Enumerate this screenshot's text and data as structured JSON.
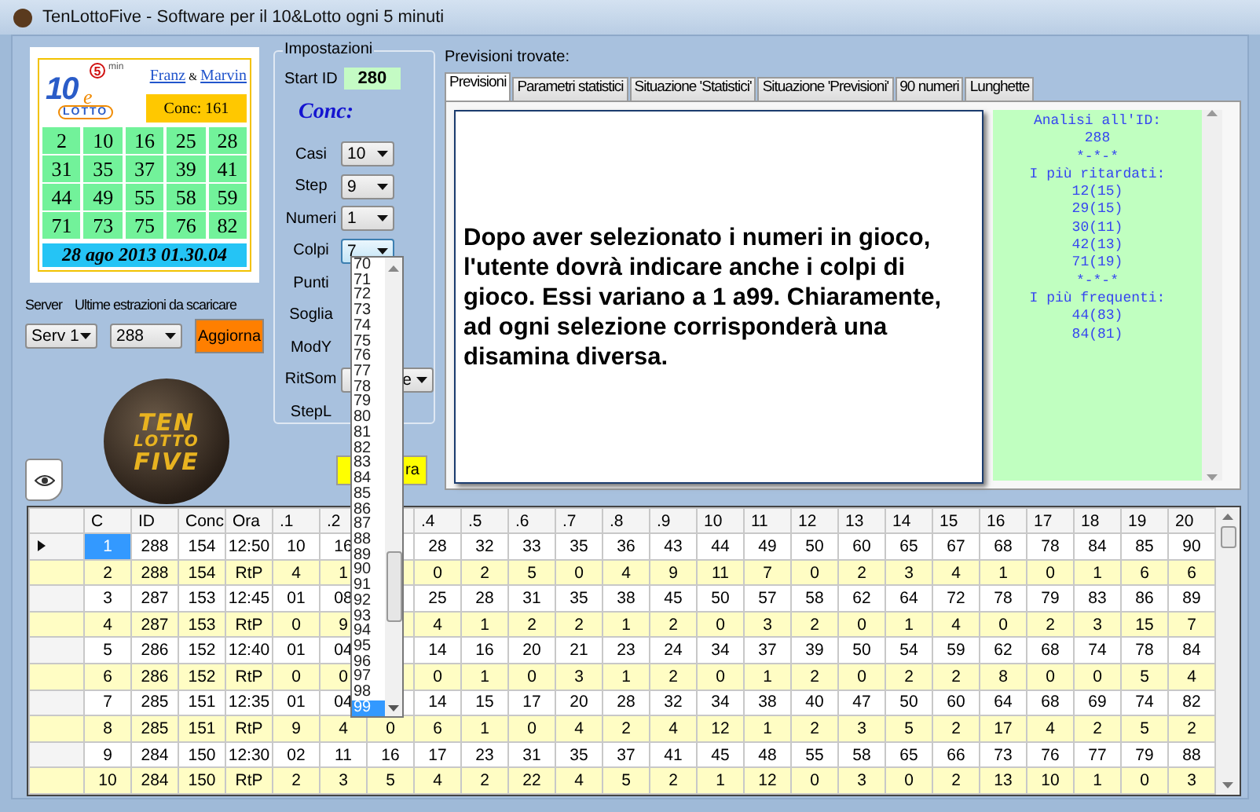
{
  "window": {
    "title": "TenLottoFive - Software per il 10&Lotto ogni 5 minuti"
  },
  "ticket": {
    "logo": {
      "number": "10",
      "letter": "e",
      "word": "LOTTO",
      "badge": "5",
      "unit": "min"
    },
    "authors": [
      "Franz",
      "Marvin"
    ],
    "separator": "&",
    "conc": "Conc: 161",
    "numbers": [
      "2",
      "10",
      "16",
      "25",
      "28",
      "31",
      "35",
      "37",
      "39",
      "41",
      "44",
      "49",
      "55",
      "58",
      "59",
      "71",
      "73",
      "75",
      "76",
      "82"
    ],
    "date": "28 ago 2013 01.30.04"
  },
  "server": {
    "label": "Server",
    "value": "Serv 1"
  },
  "download": {
    "label": "Ultime estrazioni da scaricare",
    "value": "288"
  },
  "update_button": "Aggiorna",
  "brand_logo": [
    "TEN",
    "LOTTO",
    "FIVE"
  ],
  "settings": {
    "title": "Impostazioni",
    "start_id": {
      "label": "Start ID",
      "value": "280"
    },
    "heading": "Conc:",
    "fields": [
      {
        "label": "Casi",
        "kind": "combo",
        "value": "10",
        "expanded": false
      },
      {
        "label": "Step",
        "kind": "combo",
        "value": "9",
        "expanded": false
      },
      {
        "label": "Numeri",
        "kind": "combo",
        "value": "1",
        "expanded": false
      },
      {
        "label": "Colpi",
        "kind": "combo",
        "value": "7",
        "expanded": true
      },
      {
        "label": "Punti",
        "kind": "label"
      },
      {
        "label": "Soglia",
        "kind": "label"
      },
      {
        "label": "ModY",
        "kind": "label"
      },
      {
        "label": "RitSom",
        "kind": "tail",
        "value": "e"
      },
      {
        "label": "StepL",
        "kind": "label"
      }
    ]
  },
  "dropdown": {
    "options": [
      {
        "label": "70",
        "selected": false
      },
      {
        "label": "71",
        "selected": false
      },
      {
        "label": "72",
        "selected": false
      },
      {
        "label": "73",
        "selected": false
      },
      {
        "label": "74",
        "selected": false
      },
      {
        "label": "75",
        "selected": false
      },
      {
        "label": "76",
        "selected": false
      },
      {
        "label": "77",
        "selected": false
      },
      {
        "label": "78",
        "selected": false
      },
      {
        "label": "79",
        "selected": false
      },
      {
        "label": "80",
        "selected": false
      },
      {
        "label": "81",
        "selected": false
      },
      {
        "label": "82",
        "selected": false
      },
      {
        "label": "83",
        "selected": false
      },
      {
        "label": "84",
        "selected": false
      },
      {
        "label": "85",
        "selected": false
      },
      {
        "label": "86",
        "selected": false
      },
      {
        "label": "87",
        "selected": false
      },
      {
        "label": "88",
        "selected": false
      },
      {
        "label": "89",
        "selected": false
      },
      {
        "label": "90",
        "selected": false
      },
      {
        "label": "91",
        "selected": false
      },
      {
        "label": "92",
        "selected": false
      },
      {
        "label": "93",
        "selected": false
      },
      {
        "label": "94",
        "selected": false
      },
      {
        "label": "95",
        "selected": false
      },
      {
        "label": "96",
        "selected": false
      },
      {
        "label": "97",
        "selected": false
      },
      {
        "label": "98",
        "selected": false
      },
      {
        "label": "99",
        "selected": true
      }
    ]
  },
  "action_button": "ra",
  "results_label": "Previsioni trovate:",
  "tabs": [
    {
      "label": "Previsioni",
      "selected": true
    },
    {
      "label": "Parametri statistici",
      "selected": false
    },
    {
      "label": "Situazione 'Statistici'",
      "selected": false
    },
    {
      "label": "Situazione 'Previsioni'",
      "selected": false
    },
    {
      "label": "90 numeri",
      "selected": false
    },
    {
      "label": "Lunghette",
      "selected": false
    }
  ],
  "message": "Dopo aver selezionato i numeri in gioco, l'utente dovrà indicare anche i colpi di gioco. Essi variano a 1 a99. Chiaramente, ad ogni selezione corrisponderà una disamina diversa.",
  "analysis": [
    "Analisi all'ID:",
    "288",
    "*-*-*",
    "I più ritardati:",
    "12(15)",
    "29(15)",
    "30(11)",
    "42(13)",
    "71(19)",
    "*-*-*",
    "I più frequenti:",
    "44(83)",
    "84(81)"
  ],
  "table": {
    "columns": [
      "C",
      "ID",
      "Conc",
      "Ora",
      ".1",
      ".2",
      null,
      ".4",
      ".5",
      ".6",
      ".7",
      ".8",
      ".9",
      "10",
      "11",
      "12",
      "13",
      "14",
      "15",
      "16",
      "17",
      "18",
      "19",
      "20"
    ],
    "rows": [
      {
        "kind": "draw",
        "selected": true,
        "cells": [
          "1",
          "288",
          "154",
          "12:50",
          "10",
          "16",
          null,
          "28",
          "32",
          "33",
          "35",
          "36",
          "43",
          "44",
          "49",
          "50",
          "60",
          "65",
          "67",
          "68",
          "78",
          "84",
          "85",
          "90"
        ]
      },
      {
        "kind": "delay",
        "selected": false,
        "cells": [
          "2",
          "288",
          "154",
          "RtP",
          "4",
          "1",
          null,
          "0",
          "2",
          "5",
          "0",
          "4",
          "9",
          "11",
          "7",
          "0",
          "2",
          "3",
          "4",
          "1",
          "0",
          "1",
          "6",
          "6"
        ]
      },
      {
        "kind": "draw",
        "selected": false,
        "cells": [
          "3",
          "287",
          "153",
          "12:45",
          "01",
          "08",
          null,
          "25",
          "28",
          "31",
          "35",
          "38",
          "45",
          "50",
          "57",
          "58",
          "62",
          "64",
          "72",
          "78",
          "79",
          "83",
          "86",
          "89"
        ]
      },
      {
        "kind": "delay",
        "selected": false,
        "cells": [
          "4",
          "287",
          "153",
          "RtP",
          "0",
          "9",
          null,
          "4",
          "1",
          "2",
          "2",
          "1",
          "2",
          "0",
          "3",
          "2",
          "0",
          "1",
          "4",
          "0",
          "2",
          "3",
          "15",
          "7"
        ]
      },
      {
        "kind": "draw",
        "selected": false,
        "cells": [
          "5",
          "286",
          "152",
          "12:40",
          "01",
          "04",
          null,
          "14",
          "16",
          "20",
          "21",
          "23",
          "24",
          "34",
          "37",
          "39",
          "50",
          "54",
          "59",
          "62",
          "68",
          "74",
          "78",
          "84"
        ]
      },
      {
        "kind": "delay",
        "selected": false,
        "cells": [
          "6",
          "286",
          "152",
          "RtP",
          "0",
          "0",
          null,
          "0",
          "1",
          "0",
          "3",
          "1",
          "2",
          "0",
          "1",
          "2",
          "0",
          "2",
          "2",
          "8",
          "0",
          "0",
          "5",
          "4"
        ]
      },
      {
        "kind": "draw",
        "selected": false,
        "cells": [
          "7",
          "285",
          "151",
          "12:35",
          "01",
          "04",
          null,
          "14",
          "15",
          "17",
          "20",
          "28",
          "32",
          "34",
          "38",
          "40",
          "47",
          "50",
          "60",
          "64",
          "68",
          "69",
          "74",
          "82"
        ]
      },
      {
        "kind": "delay",
        "selected": false,
        "cells": [
          "8",
          "285",
          "151",
          "RtP",
          "9",
          "4",
          "0",
          "6",
          "1",
          "0",
          "4",
          "2",
          "4",
          "12",
          "1",
          "2",
          "3",
          "5",
          "2",
          "17",
          "4",
          "2",
          "5",
          "2"
        ]
      },
      {
        "kind": "draw",
        "selected": false,
        "cells": [
          "9",
          "284",
          "150",
          "12:30",
          "02",
          "11",
          "16",
          "17",
          "23",
          "31",
          "35",
          "37",
          "41",
          "45",
          "48",
          "55",
          "58",
          "65",
          "66",
          "73",
          "76",
          "77",
          "79",
          "88"
        ]
      },
      {
        "kind": "delay",
        "selected": false,
        "cells": [
          "10",
          "284",
          "150",
          "RtP",
          "2",
          "3",
          "5",
          "4",
          "2",
          "22",
          "4",
          "5",
          "2",
          "1",
          "12",
          "0",
          "3",
          "0",
          "2",
          "13",
          "10",
          "1",
          "0",
          "3"
        ]
      }
    ]
  }
}
